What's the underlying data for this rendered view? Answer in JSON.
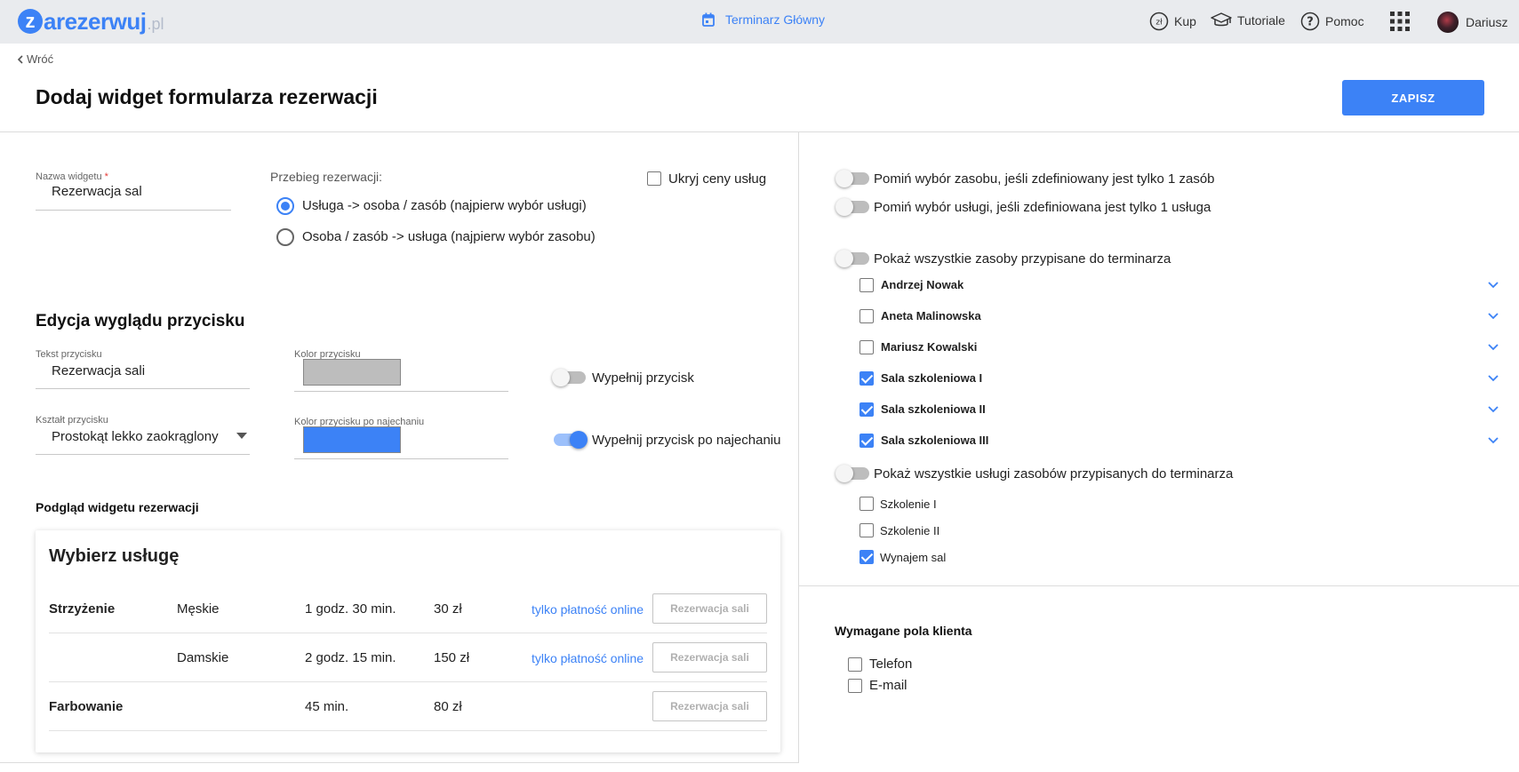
{
  "topbar": {
    "logo_word": "zarezerwuj",
    "logo_letter": "z",
    "logo_word_rest": "arezerwuj",
    "logo_tld": ".pl",
    "center_label": "Terminarz Główny",
    "buy_label": "Kup",
    "tutorials_label": "Tutoriale",
    "help_label": "Pomoc",
    "user_name": "Dariusz",
    "accent_color": "#3c82f6"
  },
  "header": {
    "back_label": "Wróć",
    "title": "Dodaj widget formularza rezerwacji",
    "save_label": "ZAPISZ"
  },
  "widget_form": {
    "name_label": "Nazwa widgetu",
    "name_required_mark": "*",
    "name_value": "Rezerwacja sal",
    "flow_label": "Przebieg rezerwacji:",
    "flow_options": [
      {
        "label": "Usługa -> osoba / zasób (najpierw wybór usługi)",
        "selected": true
      },
      {
        "label": "Osoba / zasób -> usługa (najpierw wybór zasobu)",
        "selected": false
      }
    ],
    "hide_prices_label": "Ukryj ceny usług",
    "hide_prices_checked": false
  },
  "button_edit": {
    "section_title": "Edycja wyglądu przycisku",
    "text_label": "Tekst przycisku",
    "text_value": "Rezerwacja sali",
    "color_label": "Kolor przycisku",
    "color_value": "#bdbdbd",
    "fill_label": "Wypełnij przycisk",
    "fill_on": false,
    "shape_label": "Kształt przycisku",
    "shape_value": "Prostokąt lekko zaokrąglony",
    "hover_color_label": "Kolor przycisku po najechaniu",
    "hover_color_value": "#3c82f6",
    "hover_fill_label": "Wypełnij przycisk po najechaniu",
    "hover_fill_on": true
  },
  "preview": {
    "section_title": "Podgląd widgetu rezerwacji",
    "card_title": "Wybierz usługę",
    "rows": [
      {
        "service": "Strzyżenie",
        "variant": "Męskie",
        "duration": "1 godz. 30 min.",
        "price": "30 zł",
        "note": "tylko płatność online",
        "button": "Rezerwacja sali"
      },
      {
        "service": "",
        "variant": "Damskie",
        "duration": "2 godz. 15 min.",
        "price": "150 zł",
        "note": "tylko płatność online",
        "button": "Rezerwacja sali"
      },
      {
        "service": "Farbowanie",
        "variant": "",
        "duration": "45 min.",
        "price": "80 zł",
        "note": "",
        "button": "Rezerwacja sali"
      }
    ]
  },
  "options": {
    "skip_resource_label": "Pomiń wybór zasobu, jeśli zdefiniowany jest tylko 1 zasób",
    "skip_resource_on": false,
    "skip_service_label": "Pomiń wybór usługi, jeśli zdefiniowana jest tylko 1 usługa",
    "skip_service_on": false,
    "show_all_resources_label": "Pokaż wszystkie zasoby przypisane do terminarza",
    "show_all_resources_on": false,
    "resources": [
      {
        "name": "Andrzej Nowak",
        "checked": false
      },
      {
        "name": "Aneta Malinowska",
        "checked": false
      },
      {
        "name": "Mariusz Kowalski",
        "checked": false
      },
      {
        "name": "Sala szkoleniowa I",
        "checked": true
      },
      {
        "name": "Sala szkoleniowa II",
        "checked": true
      },
      {
        "name": "Sala szkoleniowa III",
        "checked": true
      }
    ],
    "show_all_services_label": "Pokaż wszystkie usługi zasobów przypisanych do terminarza",
    "show_all_services_on": false,
    "services": [
      {
        "name": "Szkolenie I",
        "checked": false
      },
      {
        "name": "Szkolenie II",
        "checked": false
      },
      {
        "name": "Wynajem sal",
        "checked": true
      }
    ]
  },
  "required_fields": {
    "title": "Wymagane pola klienta",
    "fields": [
      {
        "name": "Telefon",
        "checked": false
      },
      {
        "name": "E-mail",
        "checked": false
      }
    ]
  }
}
